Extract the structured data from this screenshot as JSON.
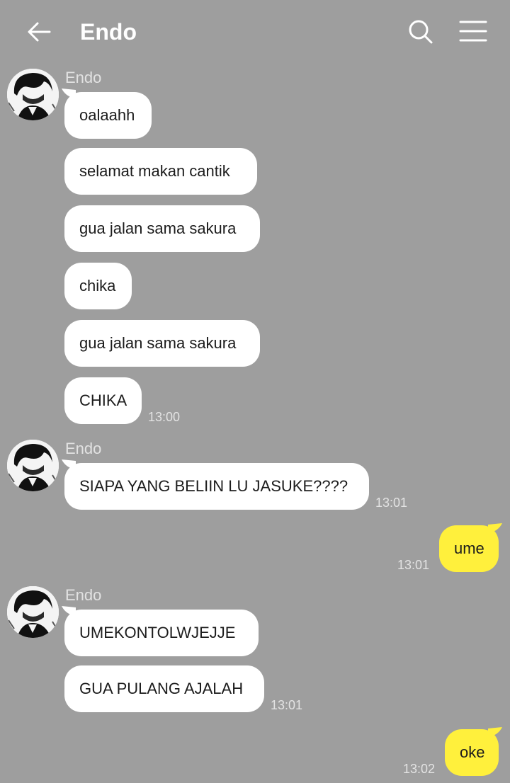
{
  "header": {
    "title": "Endo",
    "back_icon": "arrow-left-icon",
    "search_icon": "search-icon",
    "menu_icon": "hamburger-menu-icon"
  },
  "colors": {
    "background": "#9e9e9e",
    "incoming_bubble": "#ffffff",
    "outgoing_bubble": "#fff03c"
  },
  "groups": [
    {
      "sender": "Endo",
      "messages": [
        "oalaahh",
        "selamat makan cantik",
        "gua jalan sama sakura",
        "chika",
        "gua jalan sama sakura",
        "CHIKA"
      ],
      "time": "13:00"
    },
    {
      "sender": "Endo",
      "messages": [
        "SIAPA YANG BELIIN LU JASUKE????"
      ],
      "time": "13:01"
    },
    {
      "outgoing": true,
      "messages": [
        "ume"
      ],
      "time": "13:01"
    },
    {
      "sender": "Endo",
      "messages": [
        "UMEKONTOLWJEJJE",
        "GUA PULANG AJALAH"
      ],
      "time": "13:01"
    },
    {
      "outgoing": true,
      "messages": [
        "oke"
      ],
      "time": "13:02"
    }
  ]
}
